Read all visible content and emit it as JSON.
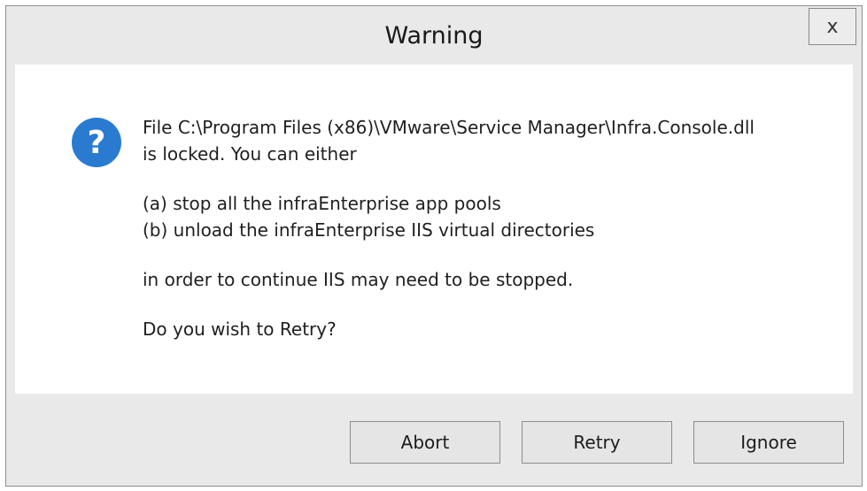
{
  "window": {
    "title": "Warning",
    "close_label": "x"
  },
  "message": {
    "icon": "question-icon",
    "line1": "File C:\\Program Files (x86)\\VMware\\Service Manager\\Infra.Console.dll",
    "line2": "is locked. You can either",
    "option_a": "(a) stop all the infraEnterprise app pools",
    "option_b": "(b) unload the infraEnterprise IIS virtual directories",
    "line3": "in order to continue IIS may need to be stopped.",
    "question": "Do you wish to Retry?"
  },
  "buttons": {
    "abort": "Abort",
    "retry": "Retry",
    "ignore": "Ignore"
  },
  "colors": {
    "icon_blue": "#2a7bd0",
    "frame": "#e9e9e9",
    "content": "#ffffff"
  }
}
